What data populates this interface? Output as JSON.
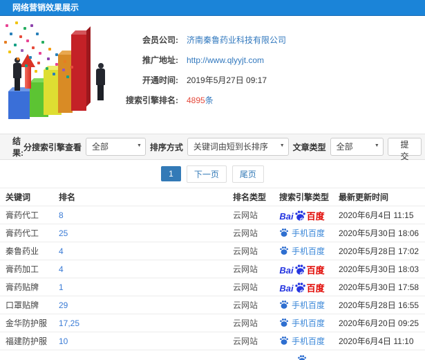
{
  "header": {
    "title": "网络营销效果展示"
  },
  "info": {
    "company_label": "会员公司:",
    "company_value": "济南秦鲁药业科技有限公司",
    "url_label": "推广地址:",
    "url_value": "http://www.qlyyjt.com",
    "opened_label": "开通时间:",
    "opened_value": "2019年5月27日 09:17",
    "rank_label": "搜索引擎排名:",
    "rank_count": "4895",
    "rank_unit": "条"
  },
  "filters": {
    "result_label": "结果:",
    "engine_label": "分搜索引擎查看",
    "engine_value": "全部",
    "sort_label": "排序方式",
    "sort_value": "关键词由短到长排序",
    "type_label": "文章类型",
    "type_value": "全部",
    "submit_label": "提交"
  },
  "pagination": {
    "current": "1",
    "next": "下一页",
    "last": "尾页"
  },
  "colors": {
    "header_blue": "#1b84d8",
    "link_blue": "#3178be",
    "rank_red": "#e4493b",
    "baidu_blue": "#2434e0",
    "baidu_red": "#e10601",
    "active_page_blue": "#337ab7"
  },
  "table": {
    "headers": [
      "关键词",
      "排名",
      "排名类型",
      "搜索引擎类型",
      "最新更新时间"
    ],
    "logo": {
      "bai": "Bai",
      "du": "du",
      "baidu_cn": "百度",
      "mobile_label": "手机百度"
    },
    "rows": [
      {
        "keyword": "膏药代工",
        "rank": "8",
        "rank_type": "云网站",
        "engine": "pc",
        "time": "2020年6月4日 11:15"
      },
      {
        "keyword": "膏药代工",
        "rank": "25",
        "rank_type": "云网站",
        "engine": "mobile",
        "time": "2020年5月30日 18:06"
      },
      {
        "keyword": "秦鲁药业",
        "rank": "4",
        "rank_type": "云网站",
        "engine": "mobile",
        "time": "2020年5月28日 17:02"
      },
      {
        "keyword": "膏药加工",
        "rank": "4",
        "rank_type": "云网站",
        "engine": "pc",
        "time": "2020年5月30日 18:03"
      },
      {
        "keyword": "膏药贴牌",
        "rank": "1",
        "rank_type": "云网站",
        "engine": "pc",
        "time": "2020年5月30日 17:58"
      },
      {
        "keyword": "口罩贴牌",
        "rank": "29",
        "rank_type": "云网站",
        "engine": "mobile",
        "time": "2020年5月28日 16:55"
      },
      {
        "keyword": "金华防护服",
        "rank": "17,25",
        "rank_type": "云网站",
        "engine": "mobile",
        "time": "2020年6月20日 09:25"
      },
      {
        "keyword": "福建防护服",
        "rank": "10",
        "rank_type": "云网站",
        "engine": "mobile",
        "time": "2020年6月4日 11:10"
      }
    ]
  }
}
